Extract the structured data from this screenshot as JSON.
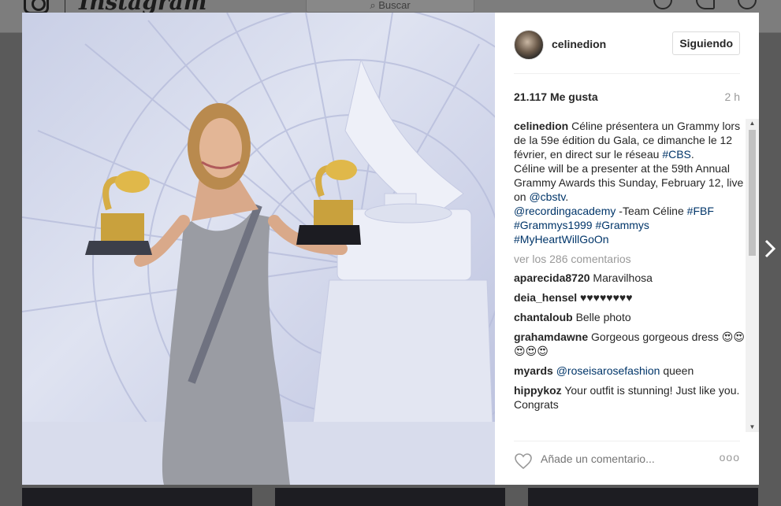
{
  "header": {
    "search_placeholder": "Buscar",
    "wordmark": "Instagram"
  },
  "post": {
    "username": "celinedion",
    "follow_label": "Siguiendo",
    "likes": "21.117 Me gusta",
    "time": "2 h",
    "caption": {
      "user": "celinedion",
      "text1": "Céline présentera un Grammy lors de la 59e édition du Gala, ce dimanche le 12 février, en direct sur le réseau ",
      "tag_cbs": "#CBS",
      "text2": ".",
      "text3": "Céline will be a presenter at the 59th Annual Grammy Awards this Sunday, February 12, live on ",
      "mention_cbstv": "@cbstv",
      "text4": ".",
      "mention_academy": "@recordingacademy",
      "text5": " -Team Céline ",
      "tag_fbf": "#FBF",
      "tag_grammys1999": "#Grammys1999",
      "tag_grammys": "#Grammys",
      "tag_heart": "#MyHeartWillGoOn"
    },
    "view_all": "ver los 286 comentarios",
    "comments": [
      {
        "user": "aparecida8720",
        "text": "Maravilhosa"
      },
      {
        "user": "deia_hensel",
        "text": "♥♥♥♥♥♥♥♥"
      },
      {
        "user": "chantaloub",
        "text": "Belle photo"
      },
      {
        "user": "grahamdawne",
        "text": "Gorgeous gorgeous dress 😍😍😍😍😍"
      },
      {
        "user": "myards",
        "mention": "@roseisarosefashion",
        "text": " queen"
      },
      {
        "user": "hippykoz",
        "text": "Your outfit is stunning! Just like you. Congrats"
      }
    ],
    "comment_placeholder": "Añade un comentario...",
    "more_label": "ooo"
  },
  "icons": {
    "next": "chevron-right-icon",
    "like": "heart-icon",
    "options": "more-options-icon"
  }
}
